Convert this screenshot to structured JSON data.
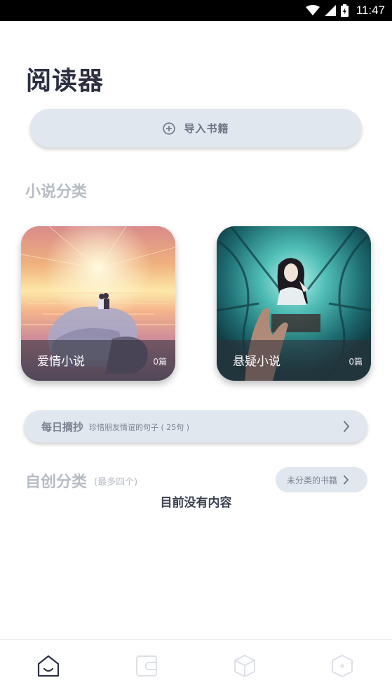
{
  "status_bar": {
    "time": "11:47",
    "icons": [
      "wifi-icon",
      "signal-icon",
      "battery-icon"
    ]
  },
  "header": {
    "title": "阅读器"
  },
  "import_button": {
    "label": "导入书籍",
    "icon": "plus-circle-icon"
  },
  "novel_section": {
    "title": "小说分类",
    "cards": [
      {
        "label": "爱情小说",
        "count": "0篇",
        "art": "sunset-couple-art"
      },
      {
        "label": "悬疑小说",
        "count": "0篇",
        "art": "mystery-girl-art"
      }
    ]
  },
  "daily_excerpt": {
    "title": "每日摘抄",
    "subtitle": "珍惜朋友情谊的句子 ( 25句 )",
    "icon": "chevron-right-icon"
  },
  "custom_section": {
    "title": "自创分类",
    "note": "(最多四个)",
    "uncategorized_label": "未分类的书籍",
    "empty_text": "目前没有内容"
  },
  "tab_bar": {
    "tabs": [
      "home-icon",
      "wallet-icon",
      "cube-icon",
      "hexagon-icon"
    ],
    "active": "home-icon"
  },
  "colors": {
    "text_dark": "#2c3142",
    "muted": "#b7bcc5",
    "pill_bg": "#e1e7ef",
    "pill_text": "#7a818f"
  }
}
